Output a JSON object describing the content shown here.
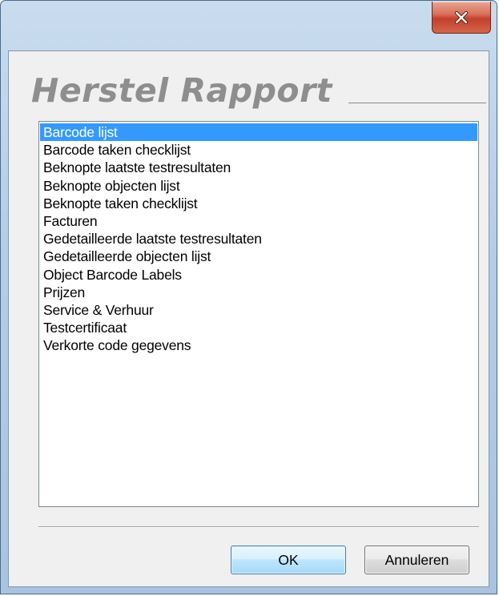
{
  "window": {
    "close_icon": "close-x-icon"
  },
  "heading": {
    "title": "Herstel Rapport"
  },
  "list": {
    "selected_index": 0,
    "items": [
      "Barcode lijst",
      "Barcode taken checklijst",
      "Beknopte laatste testresultaten",
      "Beknopte objecten lijst",
      "Beknopte taken checklijst",
      "Facturen",
      "Gedetailleerde laatste testresultaten",
      "Gedetailleerde objecten lijst",
      "Object Barcode Labels",
      "Prijzen",
      "Service & Verhuur",
      "Testcertificaat",
      "Verkorte code gegevens"
    ]
  },
  "buttons": {
    "ok_label": "OK",
    "cancel_label": "Annuleren"
  },
  "colors": {
    "selection": "#3399ff",
    "heading_text": "#8e8e8e",
    "close_button": "#c4402a"
  }
}
